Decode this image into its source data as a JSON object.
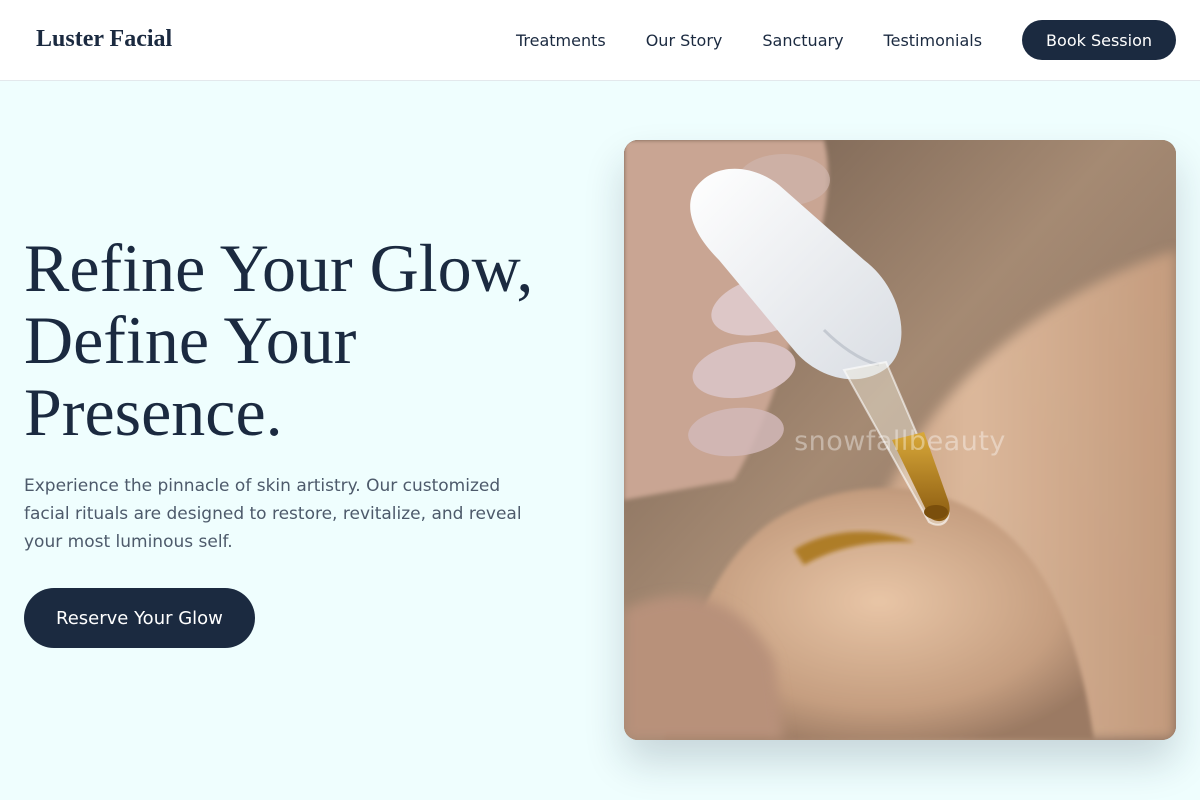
{
  "brand": {
    "name": "Luster Facial"
  },
  "nav": {
    "links": [
      "Treatments",
      "Our Story",
      "Sanctuary",
      "Testimonials"
    ],
    "cta_label": "Book Session"
  },
  "hero": {
    "title_lines": [
      "Refine Your Glow,",
      "Define Your",
      "Presence."
    ],
    "subtitle": "Experience the pinnacle of skin artistry. Our customized facial rituals are designed to restore, revitalize, and reveal your most luminous self.",
    "cta_label": "Reserve Your Glow",
    "image_watermark": "snowfallbeauty"
  },
  "colors": {
    "page_background": "#effefe",
    "header_background": "#ffffff",
    "primary_navy": "#1b2a40",
    "body_text": "#4d5a6b"
  }
}
